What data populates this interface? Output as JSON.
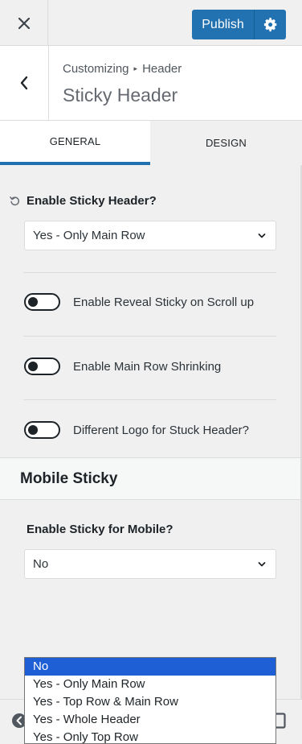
{
  "topbar": {
    "close_label": "✕",
    "publish_label": "Publish",
    "settings_icon": "gear-icon"
  },
  "panel": {
    "breadcrumb_root": "Customizing",
    "breadcrumb_sep": "▸",
    "breadcrumb_current": "Header",
    "title": "Sticky Header"
  },
  "tabs": [
    {
      "label": "GENERAL",
      "active": true
    },
    {
      "label": "DESIGN",
      "active": false
    }
  ],
  "general": {
    "sticky_label": "Enable Sticky Header?",
    "sticky_value": "Yes - Only Main Row",
    "toggles": [
      {
        "label": "Enable Reveal Sticky on Scroll up",
        "on": false
      },
      {
        "label": "Enable Main Row Shrinking",
        "on": false
      },
      {
        "label": "Different Logo for Stuck Header?",
        "on": false
      }
    ]
  },
  "mobile": {
    "section_title": "Mobile Sticky",
    "label": "Enable Sticky for Mobile?",
    "value": "No",
    "options": [
      "No",
      "Yes - Only Main Row",
      "Yes - Top Row & Main Row",
      "Yes - Whole Header",
      "Yes - Only Top Row"
    ],
    "selected_index": 0
  },
  "colors": {
    "accent": "#2271b1",
    "selected_option": "#1e5fd6"
  }
}
